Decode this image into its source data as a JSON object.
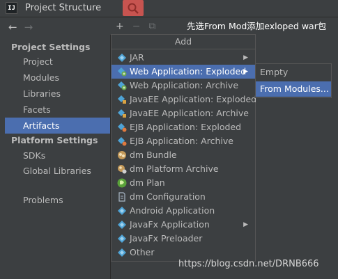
{
  "window": {
    "title": "Project Structure",
    "app_icon": "IJ"
  },
  "annotation": "先选From Mod添加exloped war包",
  "nav": {
    "back": "←",
    "forward": "→"
  },
  "toolbar": {
    "add": "+",
    "remove": "−",
    "copy": "⧉"
  },
  "sidebar": {
    "project_settings_header": "Project Settings",
    "project_items": [
      "Project",
      "Modules",
      "Libraries",
      "Facets",
      "Artifacts"
    ],
    "platform_settings_header": "Platform Settings",
    "platform_items": [
      "SDKs",
      "Global Libraries"
    ],
    "other_items": [
      "Problems"
    ],
    "selected": "Artifacts"
  },
  "add_menu": {
    "header": "Add",
    "items": [
      {
        "label": "JAR",
        "icon": "diamond-icon",
        "submenu": true
      },
      {
        "label": "Web Application: Exploded",
        "icon": "web-diamond-icon",
        "submenu": true,
        "active": true
      },
      {
        "label": "Web Application: Archive",
        "icon": "web-diamond-icon"
      },
      {
        "label": "JavaEE Application: Exploded",
        "icon": "javaee-diamond-icon"
      },
      {
        "label": "JavaEE Application: Archive",
        "icon": "javaee-diamond-icon"
      },
      {
        "label": "EJB Application: Exploded",
        "icon": "ejb-diamond-icon"
      },
      {
        "label": "EJB Application: Archive",
        "icon": "ejb-diamond-icon"
      },
      {
        "label": "dm Bundle",
        "icon": "dm-bundle-icon"
      },
      {
        "label": "dm Platform Archive",
        "icon": "dm-platform-icon"
      },
      {
        "label": "dm Plan",
        "icon": "dm-plan-icon"
      },
      {
        "label": "dm Configuration",
        "icon": "file-icon"
      },
      {
        "label": "Android Application",
        "icon": "diamond-icon"
      },
      {
        "label": "JavaFx Application",
        "icon": "diamond-icon",
        "submenu": true
      },
      {
        "label": "JavaFx Preloader",
        "icon": "diamond-icon"
      },
      {
        "label": "Other",
        "icon": "diamond-icon"
      }
    ]
  },
  "submenu": {
    "items": [
      {
        "label": "Empty"
      },
      {
        "label": "From Modules...",
        "active": true
      }
    ]
  },
  "watermark": "https://blog.csdn.net/DRNB666",
  "colors": {
    "background": "#3c3f41",
    "selection": "#4b6eaf",
    "search_badge": "#c75450"
  }
}
